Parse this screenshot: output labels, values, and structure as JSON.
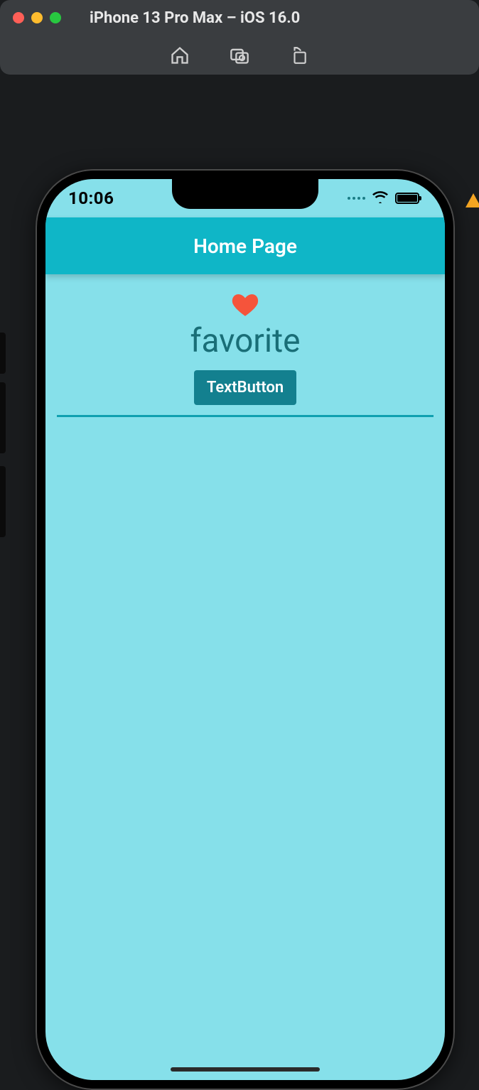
{
  "simulator": {
    "window_title": "iPhone 13 Pro Max – iOS 16.0"
  },
  "statusbar": {
    "time": "10:06"
  },
  "appbar": {
    "title": "Home Page"
  },
  "content": {
    "icon_name": "heart-icon",
    "label": "favorite",
    "button_label": "TextButton"
  },
  "colors": {
    "appbar_bg": "#0fb6c7",
    "screen_bg": "#86e0ea",
    "button_bg": "#13808f",
    "heart": "#f5543b",
    "label_text": "#196e77",
    "divider": "#0fa0b0"
  }
}
